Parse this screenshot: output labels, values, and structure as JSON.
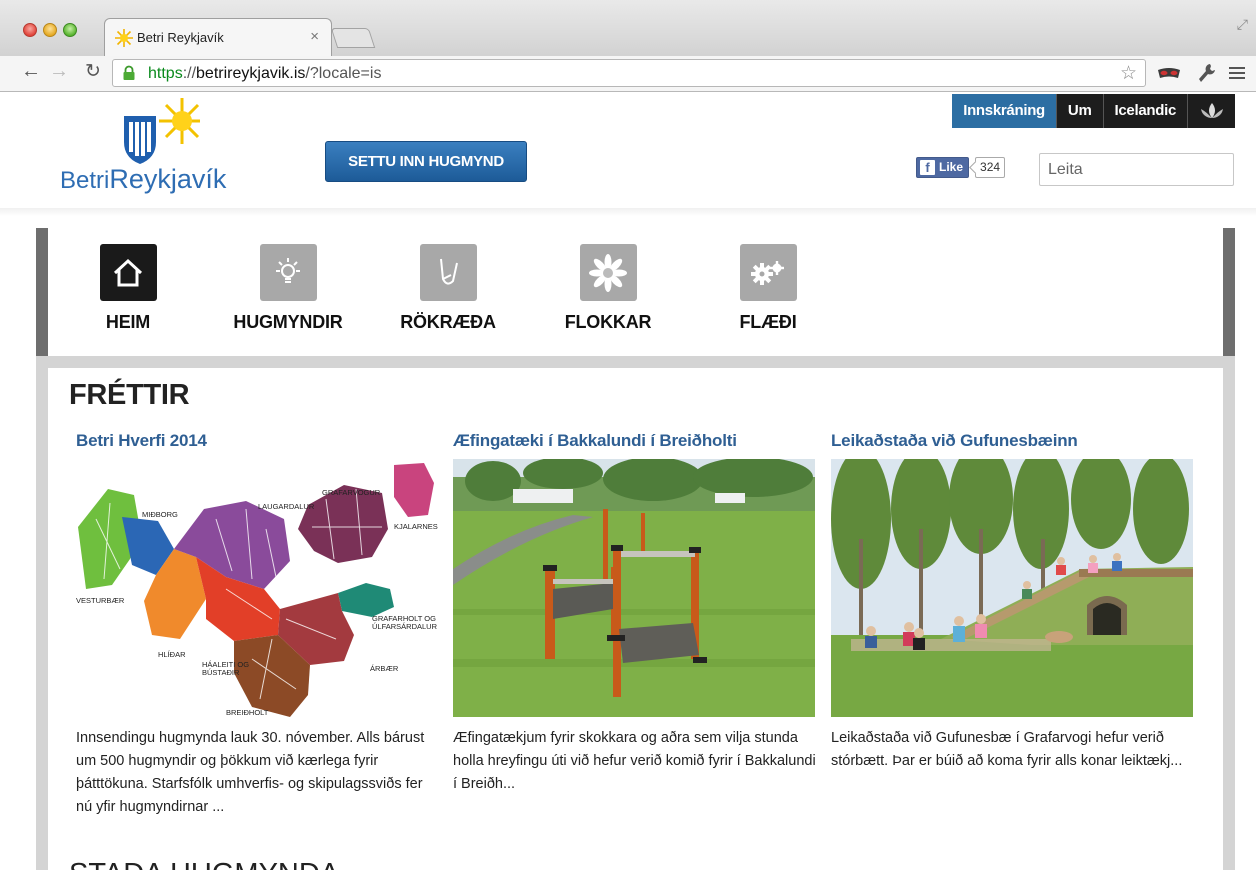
{
  "browser": {
    "tab_title": "Betri Reykjavík",
    "tab_close": "×",
    "url_scheme": "https",
    "url_separator": "://",
    "url_host": "betrireykjavik.is",
    "url_path": "/?locale=is",
    "icons": [
      "back-arrow-icon",
      "forward-arrow-icon",
      "reload-icon",
      "lock-icon",
      "star-icon",
      "mask-extension-icon",
      "wrench-icon",
      "menu-icon"
    ]
  },
  "header": {
    "topnav": {
      "login": "Innskráning",
      "about": "Um",
      "language": "Icelandic"
    },
    "logo": {
      "text_pre": "Betri",
      "text_main": "Reykjavík"
    },
    "submit_button": "SETTU INN HUGMYND",
    "facebook": {
      "like_label": "Like",
      "count": "324"
    },
    "search": {
      "placeholder": "Leita"
    }
  },
  "colors": {
    "accent_blue": "#2c6ea3",
    "link_blue": "#2f5f93",
    "nav_active": "#1a1a1a",
    "nav_inactive": "#a8a8a8"
  },
  "mainnav": {
    "items": [
      {
        "label": "HEIM",
        "icon": "home-icon",
        "active": true
      },
      {
        "label": "HUGMYNDIR",
        "icon": "lightbulb-icon",
        "active": false
      },
      {
        "label": "RÖKRÆÐA",
        "icon": "debate-icon",
        "active": false
      },
      {
        "label": "FLOKKAR",
        "icon": "flower-icon",
        "active": false
      },
      {
        "label": "FLÆÐI",
        "icon": "gears-icon",
        "active": false
      }
    ]
  },
  "news": {
    "section_title": "FRÉTTIR",
    "items": [
      {
        "title": "Betri Hverfi 2014",
        "image": "district-map",
        "text": "Innsendingu hugmynda lauk 30. nóvember. Alls bárust um 500 hugmyndir og þökkum við kærlega fyrir þátttökuna. Starfsfólk umhverfis- og skipulagssviðs fer nú yfir hugmyndirnar ...",
        "map_labels": {
          "midborg": "MIÐBORG",
          "laugardalur": "LAUGARDALUR",
          "grafarvogur": "GRAFARVOGUR",
          "kjalarnes": "KJALARNES",
          "vesturbaer": "VESTURBÆR",
          "hlidar": "HLÍÐAR",
          "haaleiti_1": "HÁALEITI OG",
          "haaleiti_2": "BÚSTAÐIR",
          "grafarholt_1": "GRAFARHOLT OG",
          "grafarholt_2": "ÚLFARSÁRDALUR",
          "arbaer": "ÁRBÆR",
          "breidholt": "BREIÐHOLT"
        }
      },
      {
        "title": "Æfingatæki í Bakkalundi í Breiðholti",
        "image": "park-exercise-equipment",
        "text": "Æfingatækjum fyrir skokkara og aðra sem vilja stunda holla hreyfingu úti við hefur verið komið fyrir í Bakkalundi í Breiðh..."
      },
      {
        "title": "Leikaðstaða við Gufunesbæinn",
        "image": "playground-children",
        "text": "Leikaðstaða við Gufunesbæ í Grafarvogi hefur verið stórbætt. Þar er búið að koma fyrir alls konar leiktækj..."
      }
    ]
  },
  "next_section": {
    "title": "STAÐA HUGMYNDA"
  }
}
